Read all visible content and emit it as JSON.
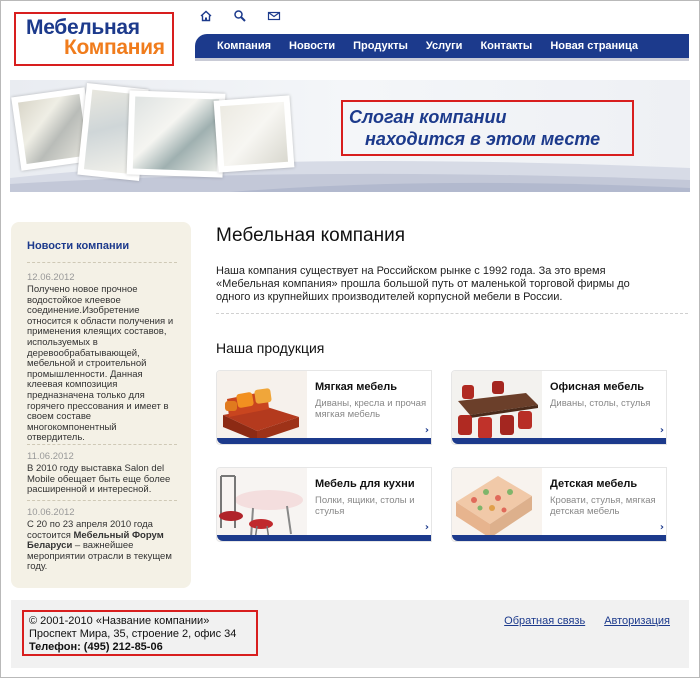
{
  "logo": {
    "line1": "Мебельная",
    "line2": "Компания"
  },
  "top_icons": [
    "home-icon",
    "search-icon",
    "mail-icon"
  ],
  "nav": {
    "items": [
      "Компания",
      "Новости",
      "Продукты",
      "Услуги",
      "Контакты",
      "Новая страница"
    ]
  },
  "banner": {
    "slogan_line1": "Слоган компании",
    "slogan_line2": "находится в этом месте"
  },
  "sidebar": {
    "title": "Новости компании",
    "news": [
      {
        "date": "12.06.2012",
        "text": "Получено новое прочное водостойкое клеевое соединение.Изобретение относится к области получения и применения клеящих составов, используемых в деревообрабатывающей, мебельной и строительной промышленности. Данная клеевая композиция предназначена только для горячего прессования и имеет в своем составе многокомпонентный отвердитель."
      },
      {
        "date": "11.06.2012",
        "text": "В 2010 году выставка Salon del Mobile обещает быть еще более расширенной и интересной."
      },
      {
        "date": "10.06.2012",
        "text_before": "С 20 по 23 апреля 2010 года состоится ",
        "text_bold": "Мебельный Форум Беларуси",
        "text_after": " – важнейшее мероприятии отрасли в текущем году."
      }
    ]
  },
  "main": {
    "title": "Мебельная компания",
    "intro": "Наша компания существует на Российском рынке с 1992 года. За это время «Мебельная компания» прошла большой путь от маленькой торговой фирмы до одного из крупнейших производителей корпусной мебели в России.",
    "products_title": "Наша продукция",
    "products": [
      {
        "title": "Мягкая мебель",
        "desc": "Диваны, кресла и прочая мягкая мебель"
      },
      {
        "title": "Офисная мебель",
        "desc": "Диваны, столы, стулья"
      },
      {
        "title": "Мебель для кухни",
        "desc": "Полки, ящики, столы и стулья"
      },
      {
        "title": "Детская мебель",
        "desc": "Кровати, стулья, мягкая детская мебель"
      }
    ]
  },
  "footer": {
    "copyright": "© 2001-2010 «Название компании»",
    "address": "Проспект Мира, 35, строение 2, офис 34",
    "phone": "Телефон: (495) 212-85-06",
    "links": [
      "Обратная связь",
      "Авторизация"
    ]
  },
  "colors": {
    "brand_blue": "#1c3a8c",
    "brand_orange": "#f07c1c",
    "highlight_red": "#d81e1e",
    "sidebar_bg": "#f4f1e6"
  }
}
